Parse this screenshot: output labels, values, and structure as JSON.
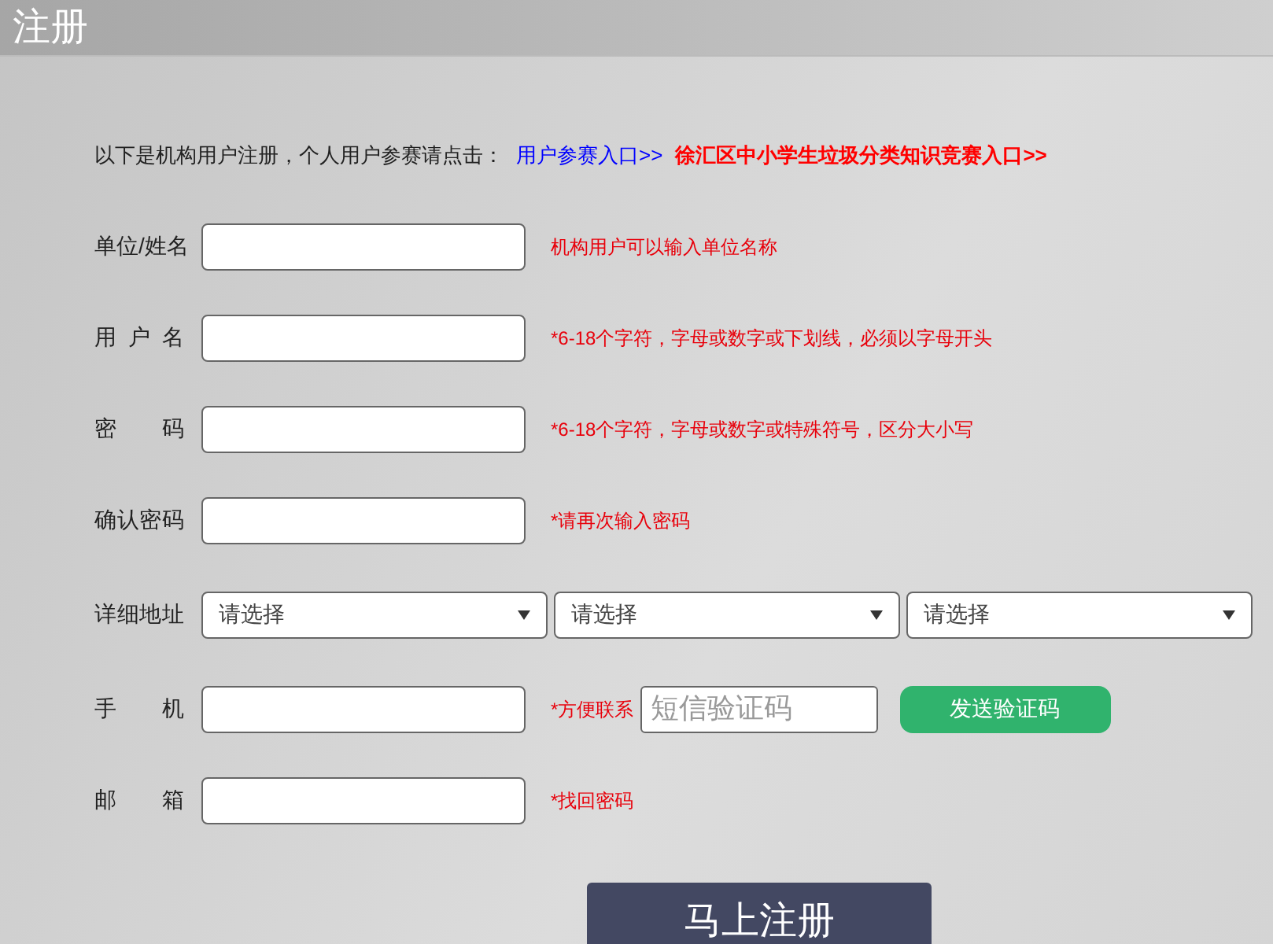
{
  "title": "注册",
  "intro": {
    "text": "以下是机构用户注册，个人用户参赛请点击：",
    "links": [
      {
        "label": "用户参赛入口>>",
        "color": "#0000ff"
      },
      {
        "label": "徐汇区中小学生垃圾分类知识竞赛入口>>",
        "color": "#ff0000"
      }
    ]
  },
  "rows": [
    {
      "kind": "text",
      "label": "单位/姓名",
      "hint": "机构用户可以输入单位名称"
    },
    {
      "kind": "text",
      "label": "用 户 名",
      "hint": "*6-18个字符，字母或数字或下划线，必须以字母开头"
    },
    {
      "kind": "text",
      "label": "密 码",
      "hint": "*6-18个字符，字母或数字或特殊符号，区分大小写"
    },
    {
      "kind": "text",
      "label": "确认密码",
      "hint": "*请再次输入密码"
    },
    {
      "kind": "select",
      "label": "详细地址",
      "selects": [
        "请选择",
        "请选择",
        "请选择"
      ]
    },
    {
      "kind": "phone",
      "label": "手 机",
      "hint": "*方便联系",
      "code_placeholder": "短信验证码",
      "send_button": "发送验证码"
    },
    {
      "kind": "text",
      "label": "邮 箱",
      "hint": "*找回密码"
    }
  ],
  "submit": "马上注册"
}
